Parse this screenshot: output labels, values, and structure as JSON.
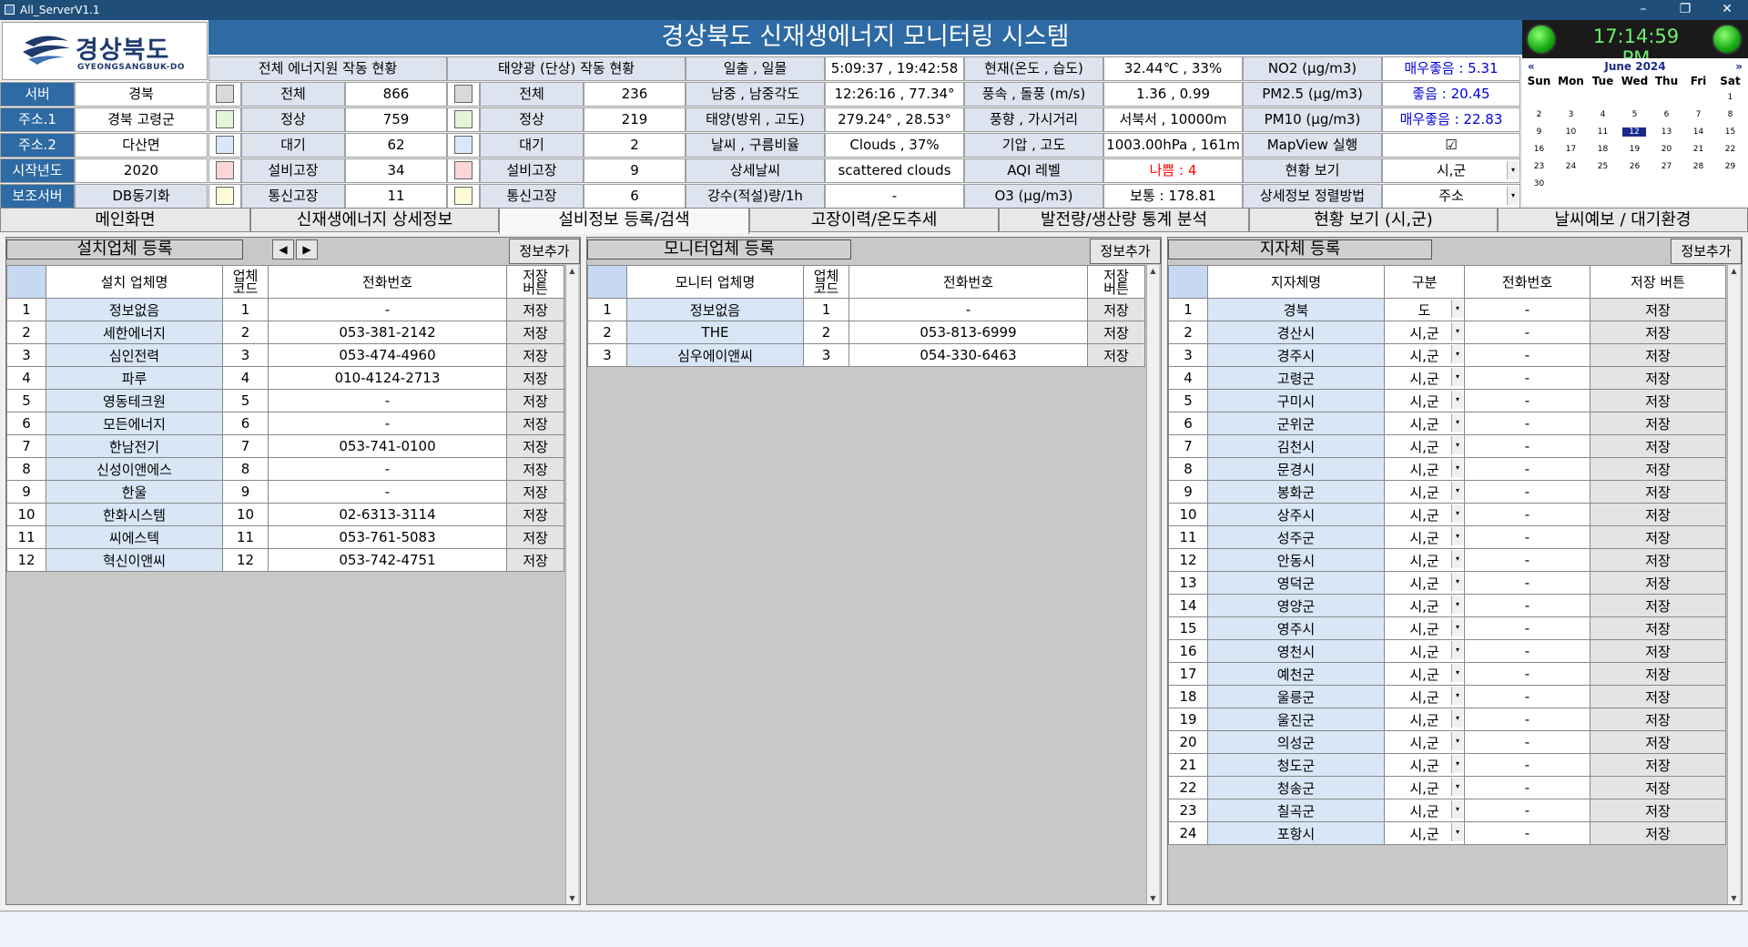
{
  "window": {
    "title": "All_ServerV1.1",
    "min": "–",
    "max": "❐",
    "close": "✕"
  },
  "logo": {
    "kr": "경상북도",
    "en": "GYEONGSANGBUK-DO"
  },
  "banner": "경상북도 신재생에너지 모니터링 시스템",
  "clock": "17:14:59 PM",
  "calendar": {
    "month": "June 2024",
    "prev": "«",
    "next": "»",
    "dow": [
      "Sun",
      "Mon",
      "Tue",
      "Wed",
      "Thu",
      "Fri",
      "Sat"
    ],
    "weeks": [
      [
        "",
        "",
        "",
        "",
        "",
        "",
        "1"
      ],
      [
        "2",
        "3",
        "4",
        "5",
        "6",
        "7",
        "8"
      ],
      [
        "9",
        "10",
        "11",
        "12",
        "13",
        "14",
        "15"
      ],
      [
        "16",
        "17",
        "18",
        "19",
        "20",
        "21",
        "22"
      ],
      [
        "23",
        "24",
        "25",
        "26",
        "27",
        "28",
        "29"
      ],
      [
        "30",
        "",
        "",
        "",
        "",
        "",
        ""
      ]
    ],
    "selected": "12"
  },
  "info": {
    "server_label": "서버",
    "server": "경북",
    "addr1_label": "주소.1",
    "addr1": "경북 고령군",
    "addr2_label": "주소.2",
    "addr2": "다산면",
    "year_label": "시작년도",
    "year": "2020",
    "aux_label": "보조서버",
    "aux": "DB동기화"
  },
  "energy": {
    "header": "전체 에너지원 작동 현황",
    "rows": [
      {
        "label": "전체",
        "value": "866",
        "color": "#d9d9d9"
      },
      {
        "label": "정상",
        "value": "759",
        "color": "#e2f5d8"
      },
      {
        "label": "대기",
        "value": "62",
        "color": "#d8e8f8"
      },
      {
        "label": "설비고장",
        "value": "34",
        "color": "#fbd6d6"
      },
      {
        "label": "통신고장",
        "value": "11",
        "color": "#fdfbd6"
      }
    ]
  },
  "solar": {
    "header": "태양광 (단상) 작동 현황",
    "rows": [
      {
        "label": "전체",
        "value": "236",
        "color": "#d9d9d9"
      },
      {
        "label": "정상",
        "value": "219",
        "color": "#e2f5d8"
      },
      {
        "label": "대기",
        "value": "2",
        "color": "#d8e8f8"
      },
      {
        "label": "설비고장",
        "value": "9",
        "color": "#fbd6d6"
      },
      {
        "label": "통신고장",
        "value": "6",
        "color": "#fdfbd6"
      }
    ]
  },
  "weather": {
    "sun_label": "일출 , 일몰",
    "sun": "5:09:37 , 19:42:58",
    "meridian_label": "남중 , 남중각도",
    "meridian": "12:26:16 , 77.34°",
    "solarpos_label": "태양(방위 , 고도)",
    "solarpos": "279.24° , 28.53°",
    "sky_label": "날씨 , 구름비율",
    "sky": "Clouds , 37%",
    "detail_label": "상세날씨",
    "detail": "scattered clouds",
    "rain_label": "강수(적설)량/1h",
    "rain": "-",
    "now_label": "현재(온도 , 습도)",
    "now": "32.44℃ , 33%",
    "wind_label": "풍속 , 돌풍 (m/s)",
    "wind": "1.36 , 0.99",
    "dir_label": "풍향 , 가시거리",
    "dir": "서북서 , 10000m",
    "press_label": "기압 , 고도",
    "press": "1003.00hPa , 161m",
    "aqi_label": "AQI 레벨",
    "aqi": "나쁨 : 4",
    "o3_label": "O3 (μg/m3)",
    "o3": "보통 : 178.81"
  },
  "air": {
    "no2_label": "NO2 (μg/m3)",
    "no2": "매우좋음 : 5.31",
    "pm25_label": "PM2.5 (μg/m3)",
    "pm25": "좋음 : 20.45",
    "pm10_label": "PM10 (μg/m3)",
    "pm10": "매우좋음 : 22.83",
    "mapview_label": "MapView 실행",
    "mapview_check": "☑",
    "status_label": "현황 보기",
    "status_value": "시,군",
    "sort_label": "상세정보 정렬방법",
    "sort_value": "주소"
  },
  "tabs": [
    "메인화면",
    "신재생에너지 상세정보",
    "설비정보 등록/검색",
    "고장이력/온도추세",
    "발전량/생산량 통계 분석",
    "현황 보기 (시,군)",
    "날씨예보 / 대기환경"
  ],
  "installers": {
    "title": "설치업체 등록",
    "nav_prev": "◀",
    "nav_next": "▶",
    "add": "정보추가",
    "cols": [
      "설치 업체명",
      "업체\n코드",
      "전화번호",
      "저장\n버튼"
    ],
    "rows": [
      {
        "n": "1",
        "name": "정보없음",
        "code": "1",
        "tel": "-",
        "btn": "저장"
      },
      {
        "n": "2",
        "name": "세한에너지",
        "code": "2",
        "tel": "053-381-2142",
        "btn": "저장"
      },
      {
        "n": "3",
        "name": "심인전력",
        "code": "3",
        "tel": "053-474-4960",
        "btn": "저장"
      },
      {
        "n": "4",
        "name": "파루",
        "code": "4",
        "tel": "010-4124-2713",
        "btn": "저장"
      },
      {
        "n": "5",
        "name": "영동테크원",
        "code": "5",
        "tel": "-",
        "btn": "저장"
      },
      {
        "n": "6",
        "name": "모든에너지",
        "code": "6",
        "tel": "-",
        "btn": "저장"
      },
      {
        "n": "7",
        "name": "한남전기",
        "code": "7",
        "tel": "053-741-0100",
        "btn": "저장"
      },
      {
        "n": "8",
        "name": "신성이앤에스",
        "code": "8",
        "tel": "-",
        "btn": "저장"
      },
      {
        "n": "9",
        "name": "한울",
        "code": "9",
        "tel": "-",
        "btn": "저장"
      },
      {
        "n": "10",
        "name": "한화시스템",
        "code": "10",
        "tel": "02-6313-3114",
        "btn": "저장"
      },
      {
        "n": "11",
        "name": "씨에스텍",
        "code": "11",
        "tel": "053-761-5083",
        "btn": "저장"
      },
      {
        "n": "12",
        "name": "혁신이앤씨",
        "code": "12",
        "tel": "053-742-4751",
        "btn": "저장"
      }
    ]
  },
  "monitors": {
    "title": "모니터업체 등록",
    "add": "정보추가",
    "cols": [
      "모니터 업체명",
      "업체\n코드",
      "전화번호",
      "저장\n버튼"
    ],
    "rows": [
      {
        "n": "1",
        "name": "정보없음",
        "code": "1",
        "tel": "-",
        "btn": "저장"
      },
      {
        "n": "2",
        "name": "THE",
        "code": "2",
        "tel": "053-813-6999",
        "btn": "저장"
      },
      {
        "n": "3",
        "name": "심우에이앤씨",
        "code": "3",
        "tel": "054-330-6463",
        "btn": "저장"
      }
    ]
  },
  "locals": {
    "title": "지자체 등록",
    "add": "정보추가",
    "cols": [
      "지자체명",
      "구분",
      "전화번호",
      "저장 버튼"
    ],
    "rows": [
      {
        "n": "1",
        "name": "경북",
        "type": "도",
        "tel": "-",
        "btn": "저장"
      },
      {
        "n": "2",
        "name": "경산시",
        "type": "시,군",
        "tel": "-",
        "btn": "저장"
      },
      {
        "n": "3",
        "name": "경주시",
        "type": "시,군",
        "tel": "-",
        "btn": "저장"
      },
      {
        "n": "4",
        "name": "고령군",
        "type": "시,군",
        "tel": "-",
        "btn": "저장"
      },
      {
        "n": "5",
        "name": "구미시",
        "type": "시,군",
        "tel": "-",
        "btn": "저장"
      },
      {
        "n": "6",
        "name": "군위군",
        "type": "시,군",
        "tel": "-",
        "btn": "저장"
      },
      {
        "n": "7",
        "name": "김천시",
        "type": "시,군",
        "tel": "-",
        "btn": "저장"
      },
      {
        "n": "8",
        "name": "문경시",
        "type": "시,군",
        "tel": "-",
        "btn": "저장"
      },
      {
        "n": "9",
        "name": "봉화군",
        "type": "시,군",
        "tel": "-",
        "btn": "저장"
      },
      {
        "n": "10",
        "name": "상주시",
        "type": "시,군",
        "tel": "-",
        "btn": "저장"
      },
      {
        "n": "11",
        "name": "성주군",
        "type": "시,군",
        "tel": "-",
        "btn": "저장"
      },
      {
        "n": "12",
        "name": "안동시",
        "type": "시,군",
        "tel": "-",
        "btn": "저장"
      },
      {
        "n": "13",
        "name": "영덕군",
        "type": "시,군",
        "tel": "-",
        "btn": "저장"
      },
      {
        "n": "14",
        "name": "영양군",
        "type": "시,군",
        "tel": "-",
        "btn": "저장"
      },
      {
        "n": "15",
        "name": "영주시",
        "type": "시,군",
        "tel": "-",
        "btn": "저장"
      },
      {
        "n": "16",
        "name": "영천시",
        "type": "시,군",
        "tel": "-",
        "btn": "저장"
      },
      {
        "n": "17",
        "name": "예천군",
        "type": "시,군",
        "tel": "-",
        "btn": "저장"
      },
      {
        "n": "18",
        "name": "울릉군",
        "type": "시,군",
        "tel": "-",
        "btn": "저장"
      },
      {
        "n": "19",
        "name": "울진군",
        "type": "시,군",
        "tel": "-",
        "btn": "저장"
      },
      {
        "n": "20",
        "name": "의성군",
        "type": "시,군",
        "tel": "-",
        "btn": "저장"
      },
      {
        "n": "21",
        "name": "청도군",
        "type": "시,군",
        "tel": "-",
        "btn": "저장"
      },
      {
        "n": "22",
        "name": "청송군",
        "type": "시,군",
        "tel": "-",
        "btn": "저장"
      },
      {
        "n": "23",
        "name": "칠곡군",
        "type": "시,군",
        "tel": "-",
        "btn": "저장"
      },
      {
        "n": "24",
        "name": "포항시",
        "type": "시,군",
        "tel": "-",
        "btn": "저장"
      }
    ]
  },
  "colors": {
    "banner": "#2e6aa3",
    "label_bg": "#2e6aa3",
    "name_cell": "#d8e6f6",
    "red": "#ff0000",
    "blue": "#0000d8"
  }
}
